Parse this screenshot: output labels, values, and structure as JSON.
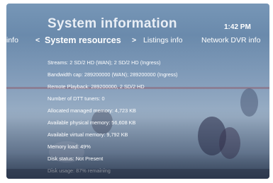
{
  "header": {
    "title": "System information",
    "time": "1:42 PM"
  },
  "tabs": {
    "prev_partial": "info",
    "prev_arrow": "<",
    "active": "System resources",
    "next_arrow": ">",
    "next": "Listings info",
    "next2": "Network DVR info"
  },
  "details": [
    "Streams: 2 SD/2 HD (WAN); 2 SD/2 HD (Ingress)",
    "Bandwidth cap: 289200000 (WAN); 289200000 (Ingress)",
    "Remote Playback: 289200000, 2 SD/2 HD",
    "Number of DTT tuners: 0",
    "Allocated managed memory: 4,723 KB",
    "Available physical memory: 56,608 KB",
    "Available virtual memory: 9,792 KB",
    "Memory load: 49%",
    "Disk status: Not Present",
    "Disk usage: 87% remaining"
  ]
}
